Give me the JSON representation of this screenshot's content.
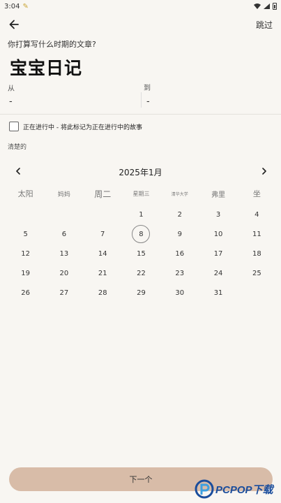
{
  "status_bar": {
    "time": "3:04"
  },
  "header": {
    "skip_label": "跳过"
  },
  "question": "你打算写什么时期的文章?",
  "diary_title": "宝宝日记",
  "date_range": {
    "from_label": "从",
    "to_label": "到",
    "from_value": "-",
    "to_value": "-"
  },
  "ongoing": {
    "label": "正在进行中 - 将此标记为正在进行中的故事",
    "checked": false
  },
  "clear_label": "清楚的",
  "calendar": {
    "month_title": "2025年1月",
    "weekdays": [
      "太阳",
      "妈妈",
      "周二",
      "星期三",
      "清华大学",
      "弗里",
      "坐"
    ],
    "leading_blanks": 3,
    "days": [
      "1",
      "2",
      "3",
      "4",
      "5",
      "6",
      "7",
      "8",
      "9",
      "10",
      "11",
      "12",
      "13",
      "14",
      "15",
      "16",
      "17",
      "18",
      "19",
      "20",
      "21",
      "22",
      "23",
      "24",
      "25",
      "26",
      "27",
      "28",
      "29",
      "30",
      "31"
    ],
    "selected_day": "8"
  },
  "next_button_label": "下一个",
  "watermark": {
    "text": "PCPOP下载"
  },
  "colors": {
    "background": "#f8f6f2",
    "button": "#d8bca8",
    "watermark": "#1a4d9c"
  }
}
